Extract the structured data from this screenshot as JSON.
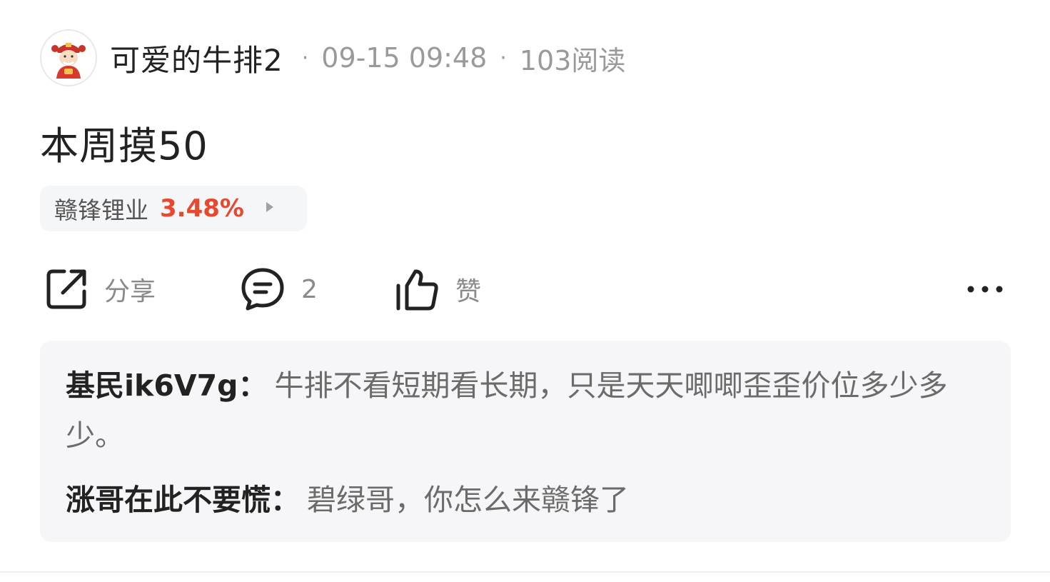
{
  "post": {
    "author": "可爱的牛排2",
    "timestamp": "09-15 09:48",
    "read_count": "103阅读",
    "content": "本周摸50",
    "avatar_icon": "caishen-avatar-icon"
  },
  "stock_tag": {
    "name": "赣锋锂业",
    "change": "3.48%",
    "change_color": "#e8482e"
  },
  "actions": {
    "share_label": "分享",
    "comment_count": "2",
    "like_label": "赞"
  },
  "comments": [
    {
      "user": "基民ik6V7g",
      "colon": "：",
      "text": "牛排不看短期看长期，只是天天唧唧歪歪价位多少多少。"
    },
    {
      "user": "涨哥在此不要慌",
      "colon": "：",
      "text": "碧绿哥，你怎么来赣锋了"
    }
  ]
}
